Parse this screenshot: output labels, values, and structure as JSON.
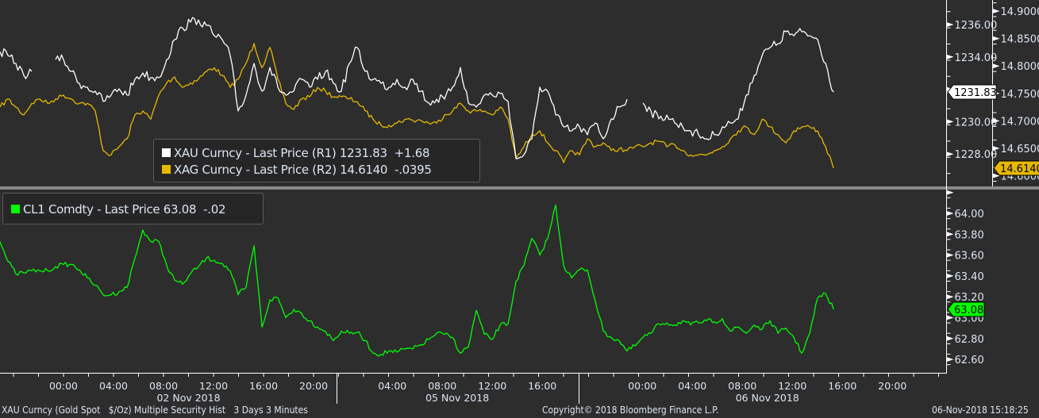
{
  "chart_data": [
    {
      "type": "line",
      "panel": "top",
      "x_unit": "trading-time hours from 02 Nov 2018 00:00",
      "x_start": -5.08,
      "x_step": 0.635,
      "series": [
        {
          "name": "XAU Curncy - Last Price (R1)",
          "axis": "R1",
          "color": "#ffffff",
          "last": "1231.83",
          "change": "+1.68",
          "values": [
            1234.33,
            1234.09,
            1233.6,
            1232.86,
            1233.11,
            null,
            null,
            1233.84,
            1233.84,
            1233.11,
            1232.37,
            1232.13,
            1231.88,
            1231.25,
            1231.64,
            1232.03,
            1231.64,
            1232.62,
            1233.01,
            1232.72,
            1232.72,
            1233.84,
            1235.07,
            1235.8,
            1236.15,
            1236.29,
            1235.95,
            1235.31,
            1235.07,
            1234.09,
            1230.66,
            1231.64,
            1233.6,
            1231.88,
            1233.35,
            1232.13,
            1231.64,
            1231.88,
            1232.62,
            1232.13,
            1232.62,
            1233.11,
            1232.37,
            1231.88,
            1233.6,
            1234.58,
            1233.11,
            1232.62,
            1232.37,
            1232.13,
            1232.62,
            1232.13,
            1232.62,
            1231.88,
            1231.15,
            1231.39,
            1231.39,
            1232.13,
            1233.35,
            1231.15,
            1230.9,
            1231.64,
            1231.64,
            1231.74,
            1231.25,
            1227.72,
            1227.96,
            1228.94,
            1232.13,
            1231.88,
            1230.41,
            1229.68,
            1229.43,
            1229.68,
            1229.19,
            1229.92,
            1228.94,
            1230.17,
            1230.9,
            1231.39,
            null,
            1231.15,
            1230.66,
            1230.17,
            1230.41,
            1229.92,
            1229.68,
            1229.43,
            1229.19,
            1228.94,
            1229.19,
            1229.68,
            1229.92,
            1230.17,
            1231.64,
            1232.86,
            1234.09,
            1234.58,
            1234.82,
            1235.56,
            1235.31,
            1235.56,
            1235.31,
            1235.07,
            1233.6,
            1231.83
          ]
        },
        {
          "name": "XAG Curncy - Last Price (R2)",
          "axis": "R2",
          "color": "#e6b800",
          "last": "14.6140",
          "change": "-.0395",
          "values": [
            14.725,
            14.74,
            14.725,
            14.711,
            14.732,
            14.74,
            14.732,
            14.74,
            14.747,
            14.74,
            14.732,
            14.732,
            14.718,
            14.646,
            14.638,
            14.653,
            14.667,
            14.711,
            14.718,
            14.703,
            14.747,
            14.769,
            14.78,
            14.761,
            14.769,
            14.776,
            14.79,
            14.797,
            14.783,
            14.761,
            14.776,
            14.805,
            14.841,
            14.797,
            14.834,
            14.776,
            14.732,
            14.721,
            14.74,
            14.744,
            14.761,
            14.754,
            14.744,
            14.744,
            14.74,
            14.735,
            14.718,
            14.703,
            14.692,
            14.692,
            14.696,
            14.703,
            14.701,
            14.701,
            14.696,
            14.696,
            14.711,
            14.718,
            14.732,
            14.718,
            14.718,
            14.718,
            14.711,
            14.725,
            14.703,
            14.631,
            14.653,
            14.675,
            14.682,
            14.66,
            14.646,
            14.624,
            14.646,
            14.638,
            14.667,
            14.653,
            14.66,
            14.646,
            14.649,
            14.646,
            14.653,
            14.653,
            14.66,
            14.663,
            14.653,
            14.657,
            14.646,
            14.638,
            14.638,
            14.638,
            14.646,
            14.653,
            14.667,
            14.682,
            14.689,
            14.675,
            14.703,
            14.689,
            14.675,
            14.66,
            14.682,
            14.689,
            14.689,
            14.682,
            14.653,
            14.614
          ]
        }
      ],
      "axes": {
        "R1": {
          "ylim": [
            1226.8,
            1237.5
          ],
          "ticks": [
            "1236.00",
            "1234.00",
            "1232.00",
            "1230.00",
            "1228.00"
          ],
          "tick_values": [
            1236,
            1234,
            1232,
            1230,
            1228
          ]
        },
        "R2": {
          "ylim": [
            14.59,
            14.92
          ],
          "ticks": [
            "14.9000",
            "14.8500",
            "14.8000",
            "14.7500",
            "14.7000",
            "14.6500",
            "14.6000"
          ],
          "tick_values": [
            14.9,
            14.85,
            14.8,
            14.75,
            14.7,
            14.65,
            14.6
          ]
        }
      }
    },
    {
      "type": "line",
      "panel": "bottom",
      "x_unit": "trading-time hours from 02 Nov 2018 00:00",
      "x_start": -5.08,
      "x_step": 0.635,
      "series": [
        {
          "name": "CL1 Comdty - Last Price",
          "color": "#00ff00",
          "last": "63.08",
          "change": "-.02",
          "values": [
            63.73,
            63.54,
            63.42,
            63.43,
            63.45,
            63.45,
            63.45,
            63.49,
            63.51,
            63.51,
            63.46,
            63.38,
            63.31,
            63.22,
            63.22,
            63.25,
            63.29,
            63.57,
            63.84,
            63.73,
            63.73,
            63.5,
            63.36,
            63.32,
            63.42,
            63.49,
            63.57,
            63.55,
            63.52,
            63.45,
            63.22,
            63.29,
            63.69,
            62.91,
            63.17,
            63.19,
            63.0,
            63.08,
            63.04,
            62.97,
            62.91,
            62.87,
            62.78,
            62.87,
            62.85,
            62.86,
            62.78,
            62.66,
            62.65,
            62.68,
            62.67,
            62.7,
            62.7,
            62.74,
            62.79,
            62.85,
            62.84,
            62.81,
            62.66,
            62.72,
            63.07,
            62.84,
            62.79,
            62.93,
            62.94,
            63.35,
            63.5,
            63.76,
            63.6,
            63.76,
            64.08,
            63.5,
            63.38,
            63.46,
            63.46,
            63.16,
            62.87,
            62.81,
            62.78,
            62.68,
            62.73,
            62.81,
            62.85,
            62.94,
            62.95,
            62.93,
            62.97,
            62.93,
            62.95,
            62.97,
            62.96,
            62.99,
            62.87,
            62.91,
            62.85,
            62.93,
            62.89,
            62.97,
            62.85,
            62.9,
            62.81,
            62.66,
            62.85,
            63.19,
            63.23,
            63.08
          ]
        }
      ],
      "axes": {
        "R1": {
          "ylim": [
            62.45,
            64.25
          ],
          "ticks": [
            "64.00",
            "63.80",
            "63.60",
            "63.40",
            "63.20",
            "63.00",
            "62.80",
            "62.60"
          ],
          "tick_values": [
            64.0,
            63.8,
            63.6,
            63.4,
            63.2,
            63.0,
            62.8,
            62.6
          ]
        }
      }
    }
  ],
  "x_axis": {
    "ticks": [
      {
        "label": "00:00",
        "x": 0
      },
      {
        "label": "04:00",
        "x": 4
      },
      {
        "label": "08:00",
        "x": 8
      },
      {
        "label": "12:00",
        "x": 12
      },
      {
        "label": "16:00",
        "x": 16
      },
      {
        "label": "20:00",
        "x": 20
      },
      {
        "label": "04:00",
        "x": 26.3
      },
      {
        "label": "08:00",
        "x": 30.3
      },
      {
        "label": "12:00",
        "x": 34.3
      },
      {
        "label": "16:00",
        "x": 38.3
      },
      {
        "label": "00:00",
        "x": 46.3
      },
      {
        "label": "04:00",
        "x": 50.3
      },
      {
        "label": "08:00",
        "x": 54.3
      },
      {
        "label": "12:00",
        "x": 58.3
      },
      {
        "label": "16:00",
        "x": 62.3
      },
      {
        "label": "20:00",
        "x": 66.3
      }
    ],
    "days": [
      {
        "label": "02 Nov 2018",
        "x": 10
      },
      {
        "label": "05 Nov 2018",
        "x": 31.5
      },
      {
        "label": "06 Nov 2018",
        "x": 56.3
      }
    ],
    "separators": [
      21.84,
      41.2
    ],
    "xlim": [
      -5.08,
      70.6
    ]
  },
  "legend_top": {
    "xau": {
      "label": "XAU Curncy - Last Price (R1) 1231.83  +1.68",
      "color": "#ffffff"
    },
    "xag": {
      "label": "XAG Curncy - Last Price (R2) 14.6140  -.0395",
      "color": "#e6b800"
    }
  },
  "legend_oil": {
    "label": "CL1 Comdty - Last Price 63.08  -.02",
    "color": "#00ff00"
  },
  "price_tags": {
    "xau": "1231.83",
    "xag": "14.6140",
    "oil": "63.08"
  },
  "footer": {
    "left": "XAU Curncy (Gold Spot   $/Oz) Multiple Security Hist   3 Days 3 Minutes",
    "center": "Copyright© 2018 Bloomberg Finance L.P.",
    "right": "06-Nov-2018 15:18:25"
  }
}
